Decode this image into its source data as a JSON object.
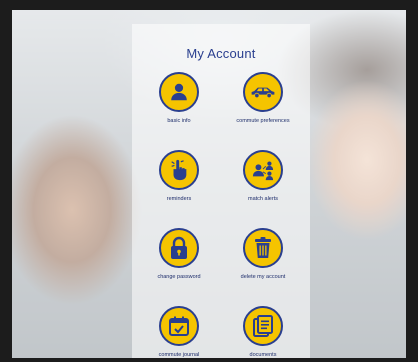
{
  "screen": {
    "title": "My Account"
  },
  "menu": [
    {
      "label": "basic info",
      "icon": "user-icon"
    },
    {
      "label": "commute preferences",
      "icon": "car-icon"
    },
    {
      "label": "reminders",
      "icon": "pointing-hand-icon"
    },
    {
      "label": "match alerts",
      "icon": "people-network-icon"
    },
    {
      "label": "change password",
      "icon": "padlock-icon"
    },
    {
      "label": "delete my account",
      "icon": "trash-icon"
    },
    {
      "label": "commute journal",
      "icon": "calendar-check-icon"
    },
    {
      "label": "documents",
      "icon": "documents-icon"
    }
  ],
  "colors": {
    "icon_fill": "#f5c400",
    "icon_ink": "#2a3f8f",
    "title": "#2a3f8f"
  }
}
